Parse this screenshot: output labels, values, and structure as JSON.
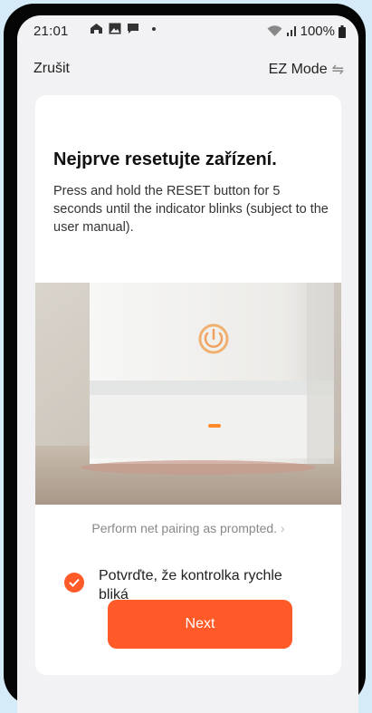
{
  "status_bar": {
    "time": "21:01",
    "battery": "100%"
  },
  "topbar": {
    "cancel_label": "Zrušit",
    "mode_label": "EZ Mode"
  },
  "card": {
    "title": "Nejprve resetujte zařízení.",
    "description": "Press and hold the RESET button for 5 seconds until the indicator blinks (subject to the user manual).",
    "hint": "Perform net pairing as prompted.",
    "confirm_label": "Potvrďte, že kontrolka rychle bliká",
    "next_label": "Next"
  },
  "colors": {
    "accent": "#ff5a27",
    "background": "#d5ebf8"
  }
}
